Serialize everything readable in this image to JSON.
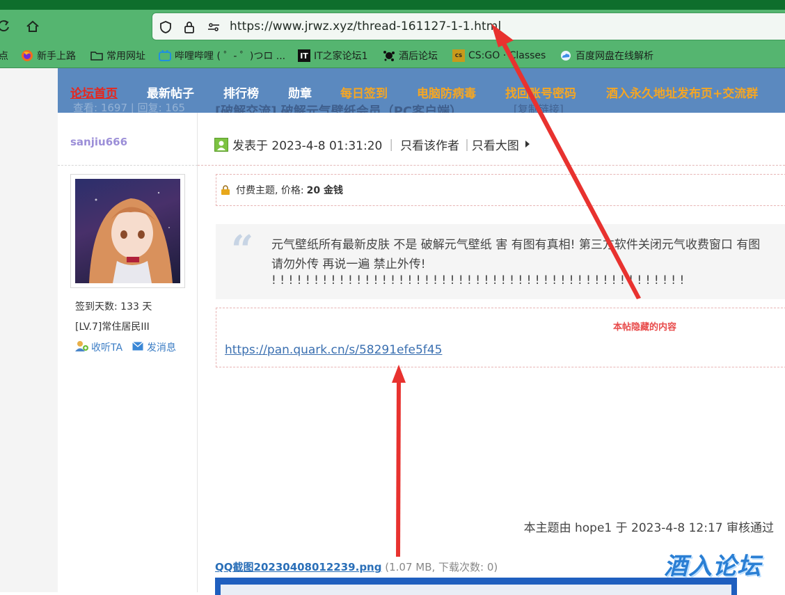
{
  "browser": {
    "url": "https://www.jrwz.xyz/thread-161127-1-1.html",
    "bookmarks": [
      {
        "label": "点",
        "icon": "bookmark-star-icon"
      },
      {
        "label": "新手上路",
        "icon": "firefox-icon"
      },
      {
        "label": "常用网址",
        "icon": "folder-icon"
      },
      {
        "label": "哔哩哔哩 ( ゜- ゜)つロ ...",
        "icon": "bilibili-icon"
      },
      {
        "label": "IT之家论坛1",
        "icon": "ithome-icon"
      },
      {
        "label": "酒后论坛",
        "icon": "splat-icon"
      },
      {
        "label": "CS:GO · Classes",
        "icon": "csgo-icon"
      },
      {
        "label": "百度网盘在线解析",
        "icon": "cloud-icon"
      }
    ]
  },
  "site_nav": {
    "items": [
      {
        "label": "论坛首页",
        "style": "home"
      },
      {
        "label": "最新帖子",
        "style": "white"
      },
      {
        "label": "排行榜",
        "style": "white"
      },
      {
        "label": "勋章",
        "style": "white"
      },
      {
        "label": "每日签到",
        "style": "orange"
      },
      {
        "label": "电脑防病毒",
        "style": "orange"
      },
      {
        "label": "找回账号密码",
        "style": "orange"
      },
      {
        "label": "酒入永久地址发布页+交流群",
        "style": "orange"
      }
    ],
    "ghost_stats": "查看: 1697 | 回复: 165",
    "ghost_title": "[破解交流] 破解元气壁纸会员（PC客户端）",
    "ghost_extra": "[复制链接]"
  },
  "author": {
    "name": "sanjiu666",
    "sign_days": "签到天数: 133 天",
    "level": "[LV.7]常住居民III",
    "follow": "收听TA",
    "message": "发消息"
  },
  "post": {
    "posted": "发表于 2023-4-8 01:31:20",
    "only_author": "只看该作者",
    "big_image": "只看大图",
    "paid": "付费主题, 价格: ",
    "price": "20 金钱",
    "quote_line1": "元气壁纸所有最新皮肤   不是 破解元气壁纸 害 有图有真相!  第三方软件关闭元气收费窗口 有图",
    "quote_line2": "请勿外传  再说一遍 禁止外传!",
    "quote_line3": "! ! ! ! ! ! ! ! ! ! ! ! ! ! ! ! ! ! ! ! ! ! ! ! ! ! ! ! ! ! ! ! ! ! ! ! ! ! ! ! ! ! ! ! ! ! ! ! !",
    "hidden_label": "本帖隐藏的内容",
    "pan_link": "https://pan.quark.cn/s/58291efe5f45",
    "review": "本主题由 hope1 于 2023-4-8 12:17 审核通过",
    "attachment_name": "QQ截图20230408012239.png",
    "attachment_meta": " (1.07 MB, 下载次数: 0)"
  },
  "watermark": "酒入论坛",
  "colors": {
    "chrome_green": "#55b570",
    "nav_blue": "#5b89bf",
    "arrow_red": "#e8322f",
    "link_blue": "#3a6fb0"
  }
}
